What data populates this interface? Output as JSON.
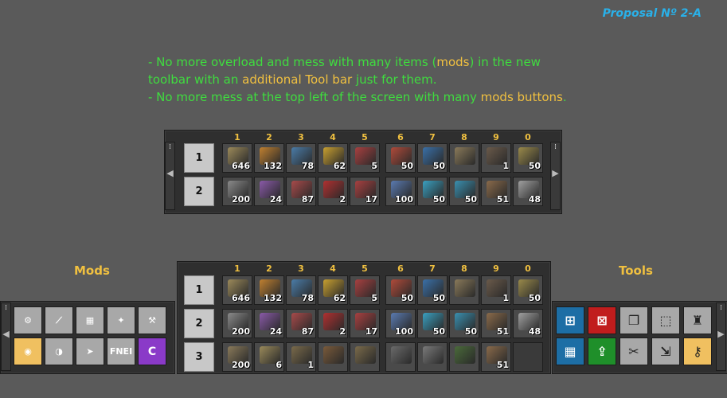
{
  "proposal": "Proposal Nº 2-A",
  "notes": {
    "line1_a": "- No more overload and mess with many items (",
    "line1_b": "mods",
    "line1_c": ") in the new",
    "line2_a": "toolbar with an ",
    "line2_b": "additional Tool bar",
    "line2_c": " just for them.",
    "line3_a": "- No more mess at the top left of the screen with many ",
    "line3_b": "mods buttons",
    "line3_c": "."
  },
  "columns": [
    "1",
    "2",
    "3",
    "4",
    "5",
    "6",
    "7",
    "8",
    "9",
    "0"
  ],
  "top_bar": {
    "rows": [
      {
        "label": "1",
        "slots": [
          {
            "icon": "transport-belt-yellow",
            "count": "646",
            "color": "#9c8a5a"
          },
          {
            "icon": "underground-belt-orange",
            "count": "132",
            "color": "#c08030"
          },
          {
            "icon": "splitter-blue",
            "count": "78",
            "color": "#4a7ca8"
          },
          {
            "icon": "inserter-yellow",
            "count": "62",
            "color": "#c8a030"
          },
          {
            "icon": "loader-red",
            "count": "5",
            "color": "#a84040"
          },
          {
            "icon": "assembler-red",
            "count": "50",
            "color": "#b04a3a"
          },
          {
            "icon": "assembler-blue",
            "count": "50",
            "color": "#3a70a8"
          },
          {
            "icon": "chest-wood",
            "count": "",
            "color": "#8a7a5a"
          },
          {
            "icon": "furnace",
            "count": "1",
            "color": "#6a5a4a"
          },
          {
            "icon": "gear-box",
            "count": "50",
            "color": "#9a8a4a"
          }
        ]
      },
      {
        "label": "2",
        "slots": [
          {
            "icon": "transport-belt-grey",
            "count": "200",
            "color": "#8a8a8a"
          },
          {
            "icon": "underground-belt-purple",
            "count": "24",
            "color": "#8a5aa8"
          },
          {
            "icon": "splitter-red",
            "count": "87",
            "color": "#a84a4a"
          },
          {
            "icon": "inserter-red",
            "count": "2",
            "color": "#b03030"
          },
          {
            "icon": "loader-red",
            "count": "17",
            "color": "#a84040"
          },
          {
            "icon": "belt-blue",
            "count": "100",
            "color": "#5a7ab0"
          },
          {
            "icon": "inserter-cyan",
            "count": "50",
            "color": "#3aa0c0"
          },
          {
            "icon": "splitter-cyan",
            "count": "50",
            "color": "#3a90b0"
          },
          {
            "icon": "pole",
            "count": "51",
            "color": "#8a6a4a"
          },
          {
            "icon": "wrench-tools",
            "count": "48",
            "color": "#a0a0a0"
          }
        ]
      }
    ]
  },
  "bottom_bar": {
    "rows": [
      {
        "label": "1",
        "slots": [
          {
            "icon": "transport-belt-yellow",
            "count": "646",
            "color": "#9c8a5a"
          },
          {
            "icon": "underground-belt-orange",
            "count": "132",
            "color": "#c08030"
          },
          {
            "icon": "splitter-blue",
            "count": "78",
            "color": "#4a7ca8"
          },
          {
            "icon": "inserter-yellow",
            "count": "62",
            "color": "#c8a030"
          },
          {
            "icon": "loader-red",
            "count": "5",
            "color": "#a84040"
          },
          {
            "icon": "assembler-red",
            "count": "50",
            "color": "#b04a3a"
          },
          {
            "icon": "assembler-blue",
            "count": "50",
            "color": "#3a70a8"
          },
          {
            "icon": "chest-wood",
            "count": "",
            "color": "#8a7a5a"
          },
          {
            "icon": "furnace",
            "count": "1",
            "color": "#6a5a4a"
          },
          {
            "icon": "gear-box",
            "count": "50",
            "color": "#9a8a4a"
          }
        ]
      },
      {
        "label": "2",
        "slots": [
          {
            "icon": "transport-belt-grey",
            "count": "200",
            "color": "#8a8a8a"
          },
          {
            "icon": "underground-belt-purple",
            "count": "24",
            "color": "#8a5aa8"
          },
          {
            "icon": "splitter-red",
            "count": "87",
            "color": "#a84a4a"
          },
          {
            "icon": "inserter-red",
            "count": "2",
            "color": "#b03030"
          },
          {
            "icon": "loader-red",
            "count": "17",
            "color": "#a84040"
          },
          {
            "icon": "belt-blue",
            "count": "100",
            "color": "#5a7ab0"
          },
          {
            "icon": "inserter-cyan",
            "count": "50",
            "color": "#3aa0c0"
          },
          {
            "icon": "splitter-cyan",
            "count": "50",
            "color": "#3a90b0"
          },
          {
            "icon": "pole",
            "count": "51",
            "color": "#8a6a4a"
          },
          {
            "icon": "wrench-tools",
            "count": "48",
            "color": "#a0a0a0"
          }
        ]
      },
      {
        "label": "3",
        "slots": [
          {
            "icon": "pipe",
            "count": "200",
            "color": "#8a7a5a"
          },
          {
            "icon": "pipe-to-ground",
            "count": "6",
            "color": "#9a8a5a"
          },
          {
            "icon": "pump",
            "count": "1",
            "color": "#7a6a4a"
          },
          {
            "icon": "offshore-pump",
            "count": "",
            "color": "#7a5a3a"
          },
          {
            "icon": "boiler",
            "count": "",
            "color": "#7a6a4a"
          },
          {
            "icon": "steam-engine",
            "count": "",
            "color": "#6a6a6a"
          },
          {
            "icon": "engine",
            "count": "",
            "color": "#7a7a7a"
          },
          {
            "icon": "pumpjack",
            "count": "",
            "color": "#4a6a3a"
          },
          {
            "icon": "pole",
            "count": "51",
            "color": "#8a6a4a"
          },
          {
            "icon": "",
            "count": "",
            "color": ""
          }
        ]
      }
    ]
  },
  "mods": {
    "title": "Mods",
    "buttons": [
      {
        "name": "mod-factory-icon",
        "label": "",
        "style": "grey"
      },
      {
        "name": "mod-rail-icon",
        "label": "",
        "style": "grey"
      },
      {
        "name": "mod-blueprint-icon",
        "label": "",
        "style": "grey"
      },
      {
        "name": "mod-robot-icon",
        "label": "",
        "style": "grey"
      },
      {
        "name": "mod-inserter-icon",
        "label": "",
        "style": "grey"
      },
      {
        "name": "mod-camera-icon",
        "label": "",
        "style": "orange"
      },
      {
        "name": "mod-daynight-icon",
        "label": "",
        "style": "grey"
      },
      {
        "name": "mod-rocket-icon",
        "label": "",
        "style": "grey"
      },
      {
        "name": "mod-fnei-icon",
        "label": "FNEI",
        "style": "grey"
      },
      {
        "name": "mod-c-icon",
        "label": "C",
        "style": "grey"
      }
    ]
  },
  "tools": {
    "title": "Tools",
    "buttons": [
      {
        "name": "tool-select-add-icon",
        "style": "blue"
      },
      {
        "name": "tool-select-remove-icon",
        "style": "red"
      },
      {
        "name": "tool-copy-icon",
        "style": "grey"
      },
      {
        "name": "tool-select-icon",
        "style": "grey"
      },
      {
        "name": "tool-ghost-icon",
        "style": "grey"
      },
      {
        "name": "tool-blueprint-icon",
        "style": "blue"
      },
      {
        "name": "tool-upgrade-icon",
        "style": "green"
      },
      {
        "name": "tool-cut-icon",
        "style": "grey"
      },
      {
        "name": "tool-paste-icon",
        "style": "grey"
      },
      {
        "name": "tool-key-icon",
        "style": "orange"
      }
    ]
  },
  "tool_glyphs": [
    "⊞",
    "⊠",
    "❐",
    "⬚",
    "♜",
    "▦",
    "⇪",
    "✂",
    "⇲",
    "⚷"
  ],
  "mod_glyphs": [
    "⚙",
    "⟋",
    "▦",
    "✦",
    "⚒",
    "◉",
    "◑",
    "➤",
    "",
    ""
  ]
}
